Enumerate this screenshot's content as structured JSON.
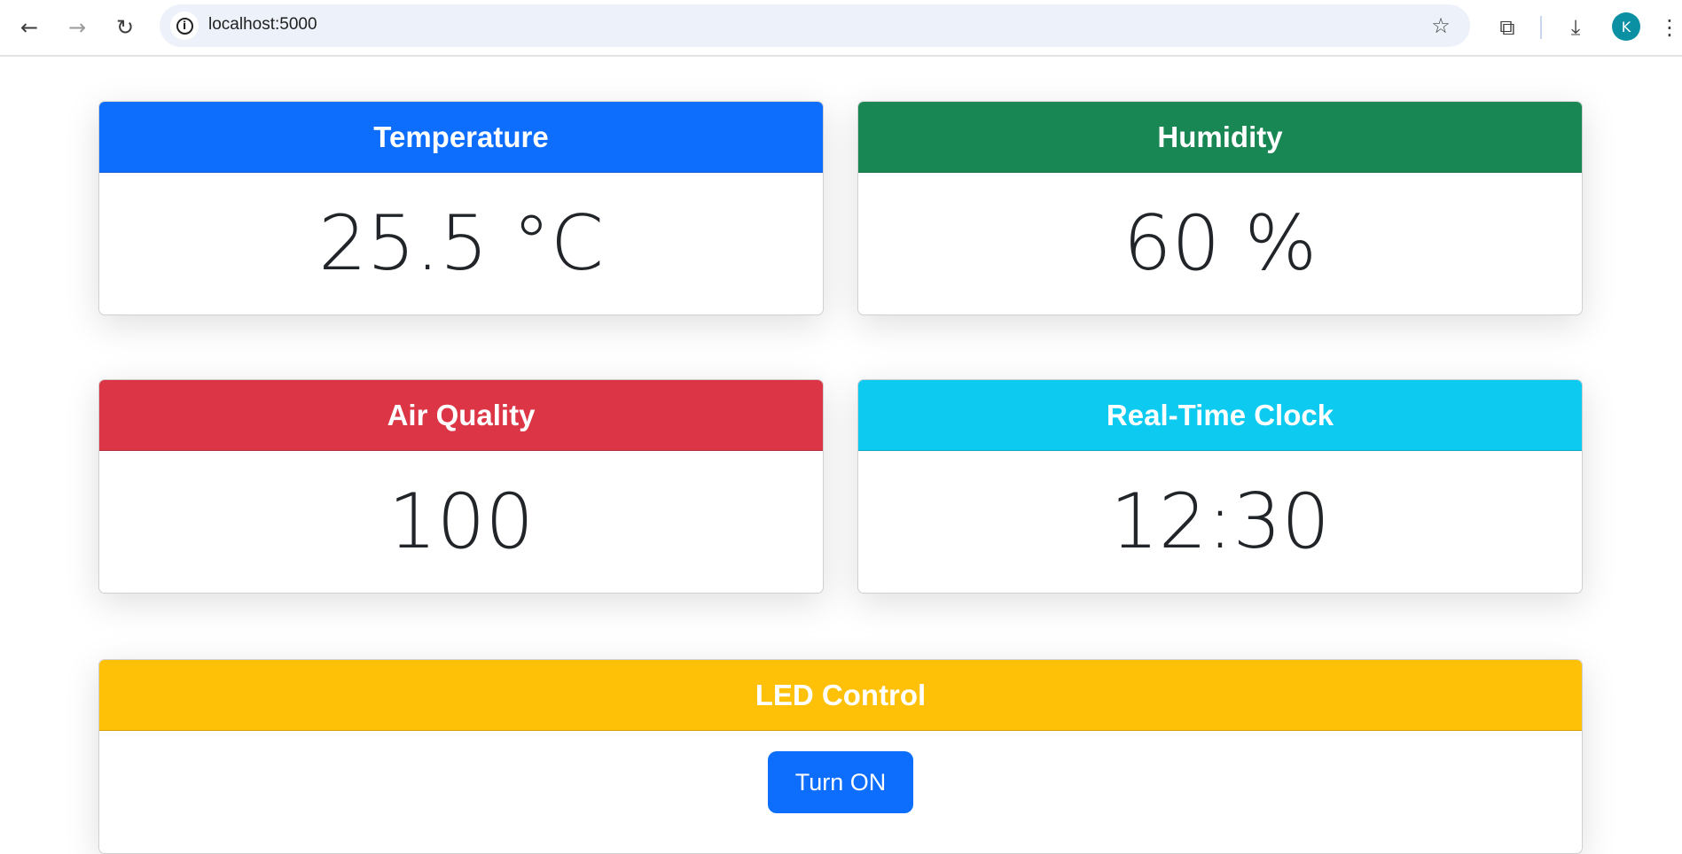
{
  "browser": {
    "url": "localhost:5000",
    "avatar_letter": "K"
  },
  "colors": {
    "temperature": "#0d6efd",
    "humidity": "#198754",
    "air_quality": "#dc3545",
    "clock": "#0dcaf0",
    "led": "#ffc107"
  },
  "cards": {
    "temperature": {
      "title": "Temperature",
      "value": "25.5 °C"
    },
    "humidity": {
      "title": "Humidity",
      "value": "60 %"
    },
    "air_quality": {
      "title": "Air Quality",
      "value": "100"
    },
    "clock": {
      "title": "Real-Time Clock",
      "value": "12:30"
    },
    "led": {
      "title": "LED Control",
      "button_label": "Turn ON"
    }
  }
}
